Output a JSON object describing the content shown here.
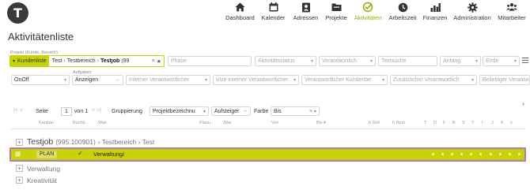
{
  "app": {
    "logo_letter": "T"
  },
  "nav": [
    {
      "label": "Dashboard",
      "icon": "home-icon",
      "active": false
    },
    {
      "label": "Kalender",
      "icon": "calendar-icon",
      "active": false
    },
    {
      "label": "Adressen",
      "icon": "address-book-icon",
      "active": false
    },
    {
      "label": "Projekte",
      "icon": "folder-icon",
      "active": false
    },
    {
      "label": "Aktivitäten",
      "icon": "activity-check-icon",
      "active": true
    },
    {
      "label": "Arbeitszeit",
      "icon": "clock-icon",
      "active": false
    },
    {
      "label": "Finanzen",
      "icon": "finance-chart-icon",
      "active": false
    },
    {
      "label": "Administration",
      "icon": "gear-icon",
      "active": false
    },
    {
      "label": "Mitarbeiter",
      "icon": "users-icon",
      "active": false
    }
  ],
  "page": {
    "title": "Aktivitätenliste"
  },
  "filters": {
    "project_label": "Projekt (Kunde, Bereich)",
    "kunden_tag": "Kundenliste",
    "crumb_1": "Test",
    "crumb_2": "Testbereich",
    "crumb_3": "Testjob",
    "crumb_3_extra": "(99",
    "phase": "Phase",
    "aktivitaetsstatus": "Aktivitätsstatus",
    "verantwortlich": "Verantwortlich",
    "textsuche": "Textsuche",
    "anfang": "Anfang",
    "ende": "Ende",
    "onoff": "OnOff",
    "aufgaben_label": "Aufgaben",
    "anzeigen": "Anzeigen",
    "interner_verantwortlicher": "Interner Verantwortlicher",
    "vize_interner": "Vize interner Verantwortlicher",
    "verantwortlicher_kundenb": "Verantwortlicher Kundenbe",
    "zusaetzlicher": "Zusätzlicher Verantwortlich",
    "beliebiger": "Beliebiger Verantw"
  },
  "toolbar": {
    "first_prev": "|< <",
    "seite_label": "Seite",
    "page_value": "1",
    "von_label": "von 1",
    "next_last": "> >|",
    "gruppierung_label": "Gruppierung",
    "gruppierung_value": "Projektbezeichnu",
    "sort_value": "Aufsteiger",
    "sort_icon": "swap-icon",
    "farbe_label": "Farbe",
    "farbe_value": "Bis"
  },
  "table": {
    "headers": [
      "Kanban",
      "Buchb..",
      "Was",
      "Planu..",
      "Wer",
      "Von",
      "Bis",
      "h Soll",
      "h Rest",
      "T",
      "D",
      "F",
      "B",
      "S",
      "T",
      "I",
      "J",
      "K",
      "x"
    ],
    "group": {
      "title": "Testjob",
      "number": "(995.100901)",
      "path": "› Testbereich › Test"
    },
    "selected_row": {
      "status": "PLAN",
      "booked": "✓",
      "text": "Verwaltung/"
    },
    "subgroups": [
      "Verwaltung",
      "Kreativität"
    ]
  },
  "colors": {
    "accent": "#c8d400",
    "selection_outline": "#b07ab4",
    "active_nav": "#9aa800"
  }
}
